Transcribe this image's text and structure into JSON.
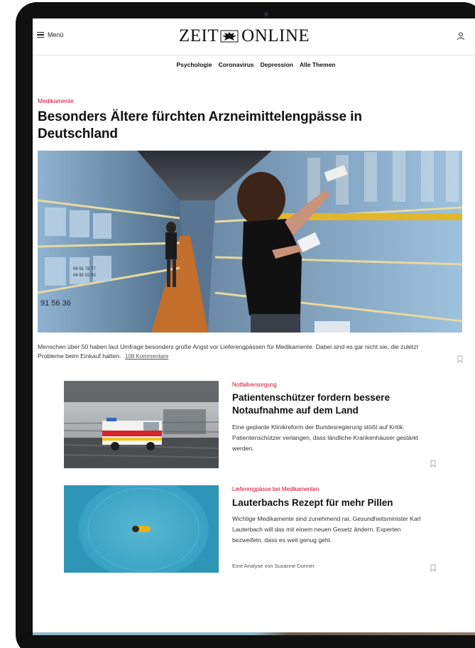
{
  "header": {
    "menu_label": "Menü",
    "logo_left": "ZEIT",
    "logo_right": "ONLINE",
    "icons": {
      "menu": "hamburger-icon",
      "logo": "eagle-emblem-icon",
      "user": "user-icon"
    }
  },
  "nav": {
    "items": [
      {
        "label": "Psychologie"
      },
      {
        "label": "Coronavirus"
      },
      {
        "label": "Depression"
      },
      {
        "label": "Alle Themen"
      }
    ]
  },
  "lead": {
    "kicker": "Medikamente",
    "title": "Besonders Ältere fürchten Arzneimittelengpässe in Deutschland",
    "teaser": "Menschen über 50 haben laut Umfrage besonders große Angst vor Lieferengpässen für Medikamente. Dabei sind es gar nicht sie, die zuletzt Probleme beim Einkauf hatten.",
    "comments": "108 Kommentare",
    "image_text": {
      "numbers_a": "91 56 36",
      "numbers_b": "04 91 78 77",
      "numbers_c": "04 92 02 03"
    }
  },
  "articles": [
    {
      "kicker": "Notfallversorgung",
      "title": "Patientenschützer fordern bessere Notaufnahme auf dem Land",
      "text": "Eine geplante Klinikreform der Bundesregierung stößt auf Kritik. Patientenschützer verlangen, dass ländliche Krankenhäuser gestärkt werden."
    },
    {
      "kicker": "Lieferengpässe bei Medikamenten",
      "title": "Lauterbachs Rezept für mehr Pillen",
      "text": "Wichtige Medikamente sind zunehmend rar, Gesundheitsminister Karl Lauterbach will das mit einem neuen Gesetz ändern. Experten bezweifeln, dass es weit genug geht.",
      "author": "Eine Analyse von Susanne Donner"
    }
  ],
  "colors": {
    "accent": "#d9002c",
    "text": "#111111",
    "frame": "#101010"
  }
}
